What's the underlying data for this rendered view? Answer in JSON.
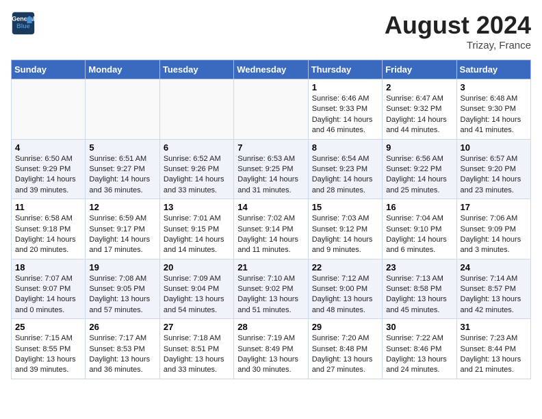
{
  "header": {
    "logo_line1": "General",
    "logo_line2": "Blue",
    "month_year": "August 2024",
    "location": "Trizay, France"
  },
  "days_of_week": [
    "Sunday",
    "Monday",
    "Tuesday",
    "Wednesday",
    "Thursday",
    "Friday",
    "Saturday"
  ],
  "weeks": [
    [
      {
        "day": "",
        "info": ""
      },
      {
        "day": "",
        "info": ""
      },
      {
        "day": "",
        "info": ""
      },
      {
        "day": "",
        "info": ""
      },
      {
        "day": "1",
        "info": "Sunrise: 6:46 AM\nSunset: 9:33 PM\nDaylight: 14 hours\nand 46 minutes."
      },
      {
        "day": "2",
        "info": "Sunrise: 6:47 AM\nSunset: 9:32 PM\nDaylight: 14 hours\nand 44 minutes."
      },
      {
        "day": "3",
        "info": "Sunrise: 6:48 AM\nSunset: 9:30 PM\nDaylight: 14 hours\nand 41 minutes."
      }
    ],
    [
      {
        "day": "4",
        "info": "Sunrise: 6:50 AM\nSunset: 9:29 PM\nDaylight: 14 hours\nand 39 minutes."
      },
      {
        "day": "5",
        "info": "Sunrise: 6:51 AM\nSunset: 9:27 PM\nDaylight: 14 hours\nand 36 minutes."
      },
      {
        "day": "6",
        "info": "Sunrise: 6:52 AM\nSunset: 9:26 PM\nDaylight: 14 hours\nand 33 minutes."
      },
      {
        "day": "7",
        "info": "Sunrise: 6:53 AM\nSunset: 9:25 PM\nDaylight: 14 hours\nand 31 minutes."
      },
      {
        "day": "8",
        "info": "Sunrise: 6:54 AM\nSunset: 9:23 PM\nDaylight: 14 hours\nand 28 minutes."
      },
      {
        "day": "9",
        "info": "Sunrise: 6:56 AM\nSunset: 9:22 PM\nDaylight: 14 hours\nand 25 minutes."
      },
      {
        "day": "10",
        "info": "Sunrise: 6:57 AM\nSunset: 9:20 PM\nDaylight: 14 hours\nand 23 minutes."
      }
    ],
    [
      {
        "day": "11",
        "info": "Sunrise: 6:58 AM\nSunset: 9:18 PM\nDaylight: 14 hours\nand 20 minutes."
      },
      {
        "day": "12",
        "info": "Sunrise: 6:59 AM\nSunset: 9:17 PM\nDaylight: 14 hours\nand 17 minutes."
      },
      {
        "day": "13",
        "info": "Sunrise: 7:01 AM\nSunset: 9:15 PM\nDaylight: 14 hours\nand 14 minutes."
      },
      {
        "day": "14",
        "info": "Sunrise: 7:02 AM\nSunset: 9:14 PM\nDaylight: 14 hours\nand 11 minutes."
      },
      {
        "day": "15",
        "info": "Sunrise: 7:03 AM\nSunset: 9:12 PM\nDaylight: 14 hours\nand 9 minutes."
      },
      {
        "day": "16",
        "info": "Sunrise: 7:04 AM\nSunset: 9:10 PM\nDaylight: 14 hours\nand 6 minutes."
      },
      {
        "day": "17",
        "info": "Sunrise: 7:06 AM\nSunset: 9:09 PM\nDaylight: 14 hours\nand 3 minutes."
      }
    ],
    [
      {
        "day": "18",
        "info": "Sunrise: 7:07 AM\nSunset: 9:07 PM\nDaylight: 14 hours\nand 0 minutes."
      },
      {
        "day": "19",
        "info": "Sunrise: 7:08 AM\nSunset: 9:05 PM\nDaylight: 13 hours\nand 57 minutes."
      },
      {
        "day": "20",
        "info": "Sunrise: 7:09 AM\nSunset: 9:04 PM\nDaylight: 13 hours\nand 54 minutes."
      },
      {
        "day": "21",
        "info": "Sunrise: 7:10 AM\nSunset: 9:02 PM\nDaylight: 13 hours\nand 51 minutes."
      },
      {
        "day": "22",
        "info": "Sunrise: 7:12 AM\nSunset: 9:00 PM\nDaylight: 13 hours\nand 48 minutes."
      },
      {
        "day": "23",
        "info": "Sunrise: 7:13 AM\nSunset: 8:58 PM\nDaylight: 13 hours\nand 45 minutes."
      },
      {
        "day": "24",
        "info": "Sunrise: 7:14 AM\nSunset: 8:57 PM\nDaylight: 13 hours\nand 42 minutes."
      }
    ],
    [
      {
        "day": "25",
        "info": "Sunrise: 7:15 AM\nSunset: 8:55 PM\nDaylight: 13 hours\nand 39 minutes."
      },
      {
        "day": "26",
        "info": "Sunrise: 7:17 AM\nSunset: 8:53 PM\nDaylight: 13 hours\nand 36 minutes."
      },
      {
        "day": "27",
        "info": "Sunrise: 7:18 AM\nSunset: 8:51 PM\nDaylight: 13 hours\nand 33 minutes."
      },
      {
        "day": "28",
        "info": "Sunrise: 7:19 AM\nSunset: 8:49 PM\nDaylight: 13 hours\nand 30 minutes."
      },
      {
        "day": "29",
        "info": "Sunrise: 7:20 AM\nSunset: 8:48 PM\nDaylight: 13 hours\nand 27 minutes."
      },
      {
        "day": "30",
        "info": "Sunrise: 7:22 AM\nSunset: 8:46 PM\nDaylight: 13 hours\nand 24 minutes."
      },
      {
        "day": "31",
        "info": "Sunrise: 7:23 AM\nSunset: 8:44 PM\nDaylight: 13 hours\nand 21 minutes."
      }
    ]
  ]
}
